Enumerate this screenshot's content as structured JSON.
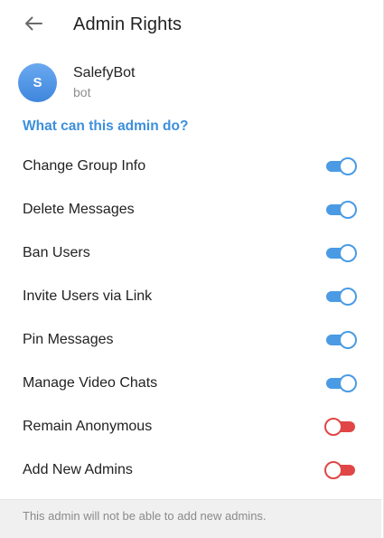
{
  "header": {
    "title": "Admin Rights"
  },
  "bot": {
    "avatar_letter": "S",
    "name": "SalefyBot",
    "status": "bot"
  },
  "section": {
    "title": "What can this admin do?"
  },
  "rights": [
    {
      "label": "Change Group Info",
      "enabled": true
    },
    {
      "label": "Delete Messages",
      "enabled": true
    },
    {
      "label": "Ban Users",
      "enabled": true
    },
    {
      "label": "Invite Users via Link",
      "enabled": true
    },
    {
      "label": "Pin Messages",
      "enabled": true
    },
    {
      "label": "Manage Video Chats",
      "enabled": true
    },
    {
      "label": "Remain Anonymous",
      "enabled": false
    },
    {
      "label": "Add New Admins",
      "enabled": false
    }
  ],
  "footer": {
    "note": "This admin will not be able to add new admins."
  },
  "colors": {
    "accent": "#4a9be4",
    "off": "#e04646",
    "section_header": "#3d8fdc"
  }
}
